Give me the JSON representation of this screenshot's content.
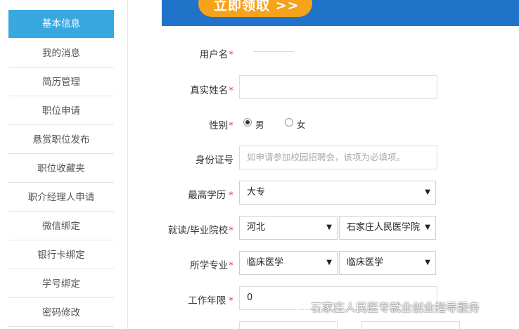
{
  "sidebar": {
    "items": [
      {
        "label": "基本信息",
        "active": true
      },
      {
        "label": "我的消息"
      },
      {
        "label": "简历管理"
      },
      {
        "label": "职位申请"
      },
      {
        "label": "悬赏职位发布"
      },
      {
        "label": "职位收藏夹"
      },
      {
        "label": "职介经理人申请"
      },
      {
        "label": "微信绑定"
      },
      {
        "label": "银行卡绑定"
      },
      {
        "label": "学号绑定"
      },
      {
        "label": "密码修改"
      }
    ]
  },
  "banner": {
    "button_label": "立即领取 >>",
    "background": "#1f73c8",
    "button_color": "#f7a21b"
  },
  "form": {
    "username_label": "用户名",
    "realname_label": "真实姓名",
    "realname_value": "",
    "gender_label": "性别",
    "gender_male": "男",
    "gender_female": "女",
    "gender_selected": "男",
    "idcard_label": "身份证号",
    "idcard_placeholder": "如申请参加校园招聘会，该项为必填项。",
    "education_label": "最高学历",
    "education_value": "大专",
    "school_label": "就读/毕业院校",
    "school_province": "河北",
    "school_name": "石家庄人民医学院",
    "major_label": "所学专业",
    "major_category": "临床医学",
    "major_name": "临床医学",
    "work_years_label": "工作年限",
    "work_years_value": "0",
    "required_mark": "*",
    "required_color": "#e53935"
  },
  "watermark": {
    "text": "石家庄人民医专就业创业指导服务",
    "icon": "wechat-icon"
  }
}
